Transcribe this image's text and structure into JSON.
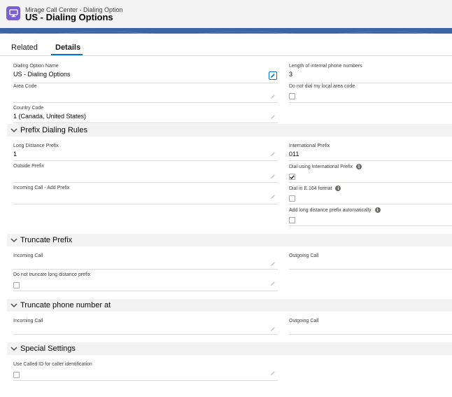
{
  "header": {
    "object_label": "Mirage Call Center - Dialing Option",
    "record_title": "US - Dialing Options",
    "icon": "monitor-icon",
    "icon_color": "#7a5fd0",
    "banner_color": "#3a67a3"
  },
  "tabs": [
    {
      "label": "Related",
      "active": false
    },
    {
      "label": "Details",
      "active": true
    }
  ],
  "accent_color": "#0176d3",
  "fields": {
    "dialing_option_name": {
      "label": "Dialing Option Name",
      "value": "US - Dialing Options"
    },
    "area_code": {
      "label": "Area Code",
      "value": ""
    },
    "country_code": {
      "label": "Country Code",
      "value": "1 (Canada, United States)"
    },
    "length_internal": {
      "label": "Length of internal phone numbers",
      "value": "3"
    },
    "do_not_dial_local": {
      "label": "Do not dial my local area code",
      "checked": false
    },
    "long_distance_prefix": {
      "label": "Long Distance Prefix",
      "value": "1"
    },
    "outside_prefix": {
      "label": "Outside Prefix",
      "value": ""
    },
    "incoming_add_prefix": {
      "label": "Incoming Call - Add Prefix",
      "value": ""
    },
    "international_prefix": {
      "label": "International Prefix",
      "value": "011"
    },
    "dial_using_international": {
      "label": "Dial using International Prefix",
      "checked": true
    },
    "dial_e164": {
      "label": "Dial in E.164 format",
      "checked": false
    },
    "add_long_distance_auto": {
      "label": "Add long distance prefix automatically",
      "checked": false
    },
    "truncate_incoming": {
      "label": "Incoming Call",
      "value": ""
    },
    "truncate_outgoing": {
      "label": "Outgoing Call",
      "value": ""
    },
    "do_not_truncate_ld": {
      "label": "Do not truncate long distance prefix",
      "checked": false
    },
    "tpn_incoming": {
      "label": "Incoming Call",
      "value": ""
    },
    "tpn_outgoing": {
      "label": "Outgoing Call",
      "value": ""
    },
    "use_called_id": {
      "label": "Use Called ID for caller identification",
      "checked": false
    }
  },
  "sections": {
    "prefix_dialing_rules": "Prefix Dialing Rules",
    "truncate_prefix": "Truncate Prefix",
    "truncate_phone_number_at": "Truncate phone number at",
    "special_settings": "Special Settings"
  }
}
